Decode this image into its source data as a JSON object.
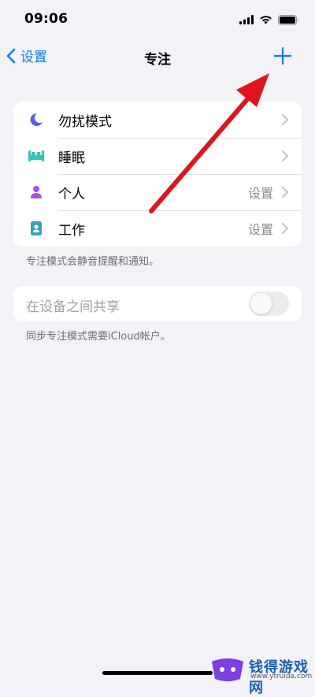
{
  "status": {
    "time": "09:06"
  },
  "nav": {
    "back_label": "设置",
    "title": "专注"
  },
  "focus_modes": [
    {
      "label": "勿扰模式",
      "detail": "",
      "icon": "moon-icon",
      "color": "#5e5ce6"
    },
    {
      "label": "睡眠",
      "detail": "",
      "icon": "bed-icon",
      "color": "#34c3b4"
    },
    {
      "label": "个人",
      "detail": "设置",
      "icon": "person-icon",
      "color": "#af52de"
    },
    {
      "label": "工作",
      "detail": "设置",
      "icon": "id-badge-icon",
      "color": "#32a6b8"
    }
  ],
  "footnote_focus": "专注模式会静音提醒和通知。",
  "share": {
    "label": "在设备之间共享",
    "toggle_on": false
  },
  "footnote_share": "同步专注模式需要iCloud帐户。",
  "watermark": {
    "text": "钱得游戏网",
    "url": "www.ytruida.com"
  },
  "colors": {
    "accent": "#0a7aff",
    "annotation_arrow": "#e0141e",
    "background": "#f2f2f7"
  }
}
